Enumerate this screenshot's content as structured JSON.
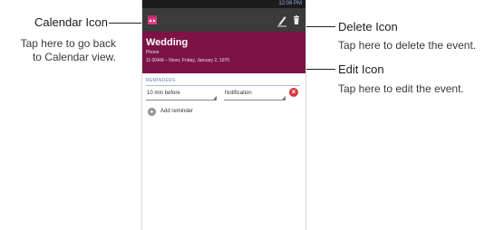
{
  "callouts": {
    "calendar": {
      "title": "Calendar Icon",
      "desc_line1": "Tap here to go back",
      "desc_line2": "to Calendar view."
    },
    "delete": {
      "title": "Delete Icon",
      "desc": "Tap here to delete the event."
    },
    "edit": {
      "title": "Edit Icon",
      "desc": "Tap here to edit the event."
    }
  },
  "status_bar": {
    "time": "12:08 PM"
  },
  "action_bar": {
    "calendar_icon": "calendar-icon",
    "edit_icon": "pencil-icon",
    "delete_icon": "trash-icon"
  },
  "event": {
    "title": "Wedding",
    "calendar": "Phone",
    "time": "11:00AM – Noon, Friday, January 2, 1970"
  },
  "reminders": {
    "label": "REMINDERS",
    "time_value": "10 min before",
    "method_value": "Notification",
    "remove_icon": "remove-icon",
    "add_label": "Add reminder"
  },
  "colors": {
    "event_header": "#7b1347",
    "action_bar": "#3b3b3b",
    "accent": "#5b7fb4",
    "remove": "#d8363d"
  }
}
